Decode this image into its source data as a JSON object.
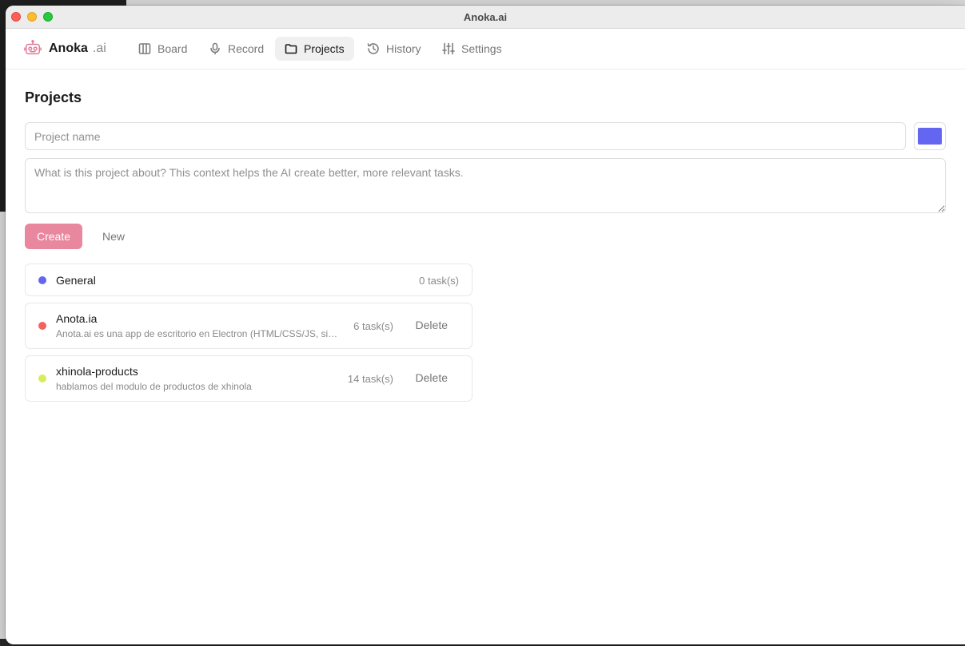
{
  "window": {
    "title": "Anoka.ai"
  },
  "brand": {
    "name": "Anoka",
    "suffix": ".ai",
    "logo_icon": "robot-icon",
    "logo_color": "#e07a96"
  },
  "nav": {
    "items": [
      {
        "label": "Board",
        "icon": "columns-icon",
        "active": false
      },
      {
        "label": "Record",
        "icon": "microphone-icon",
        "active": false
      },
      {
        "label": "Projects",
        "icon": "folder-icon",
        "active": true
      },
      {
        "label": "History",
        "icon": "history-icon",
        "active": false
      },
      {
        "label": "Settings",
        "icon": "sliders-icon",
        "active": false
      }
    ]
  },
  "page": {
    "title": "Projects"
  },
  "form": {
    "name_placeholder": "Project name",
    "name_value": "",
    "color_value": "#6366f1",
    "description_placeholder": "What is this project about? This context helps the AI create better, more relevant tasks.",
    "description_value": "",
    "create_label": "Create",
    "create_color": "#e8879e",
    "new_label": "New"
  },
  "projects": [
    {
      "name": "General",
      "description": "",
      "count": "0 task(s)",
      "color": "#6366f1",
      "deletable": false
    },
    {
      "name": "Anota.ia",
      "description": "Anota.ai es una app de escritorio en Electron (HTML/CSS/JS, sin frameworks)",
      "count": "6 task(s)",
      "color": "#ef6461",
      "deletable": true,
      "delete_label": "Delete"
    },
    {
      "name": "xhinola-products",
      "description": "hablamos del modulo de productos de xhinola",
      "count": "14 task(s)",
      "color": "#d9ec5a",
      "deletable": true,
      "delete_label": "Delete"
    }
  ]
}
